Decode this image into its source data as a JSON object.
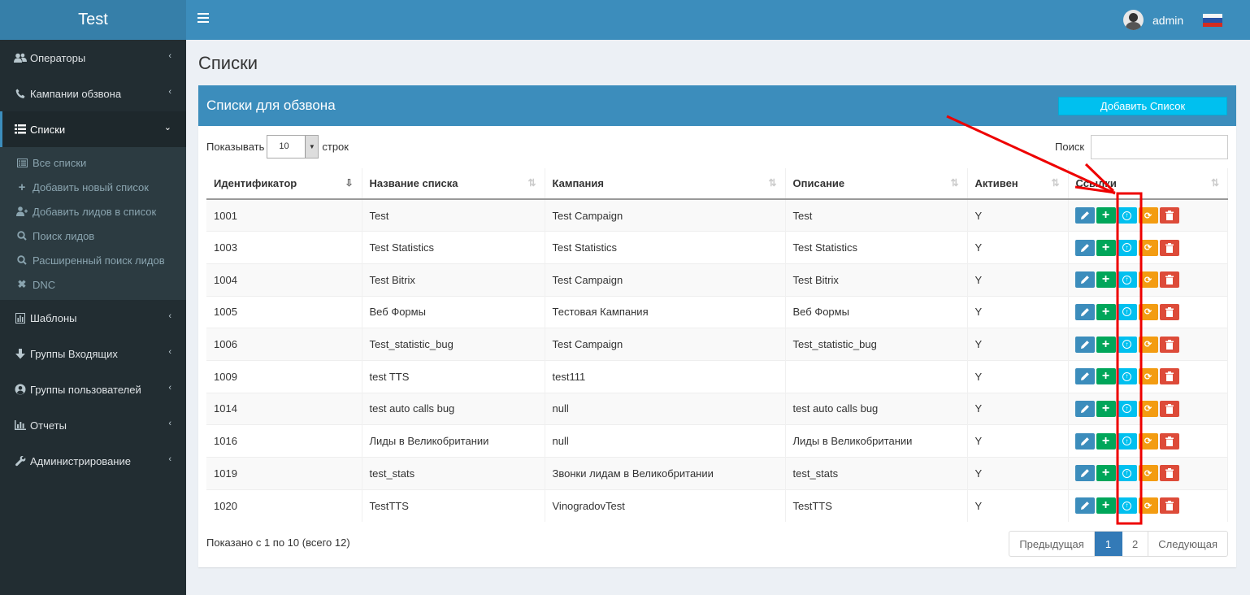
{
  "app": {
    "title": "Test"
  },
  "header": {
    "user": "admin"
  },
  "sidebar": {
    "items": [
      {
        "label": "Операторы",
        "icon": "users-icon"
      },
      {
        "label": "Кампании обзвона",
        "icon": "phone-icon"
      },
      {
        "label": "Списки",
        "icon": "list-icon",
        "active": true
      },
      {
        "label": "Шаблоны",
        "icon": "template-icon"
      },
      {
        "label": "Группы Входящих",
        "icon": "arrow-down-icon"
      },
      {
        "label": "Группы пользователей",
        "icon": "user-circle-icon"
      },
      {
        "label": "Отчеты",
        "icon": "bar-chart-icon"
      },
      {
        "label": "Администрирование",
        "icon": "wrench-icon"
      }
    ],
    "subitems": [
      {
        "label": "Все списки",
        "icon": "list-alt-icon"
      },
      {
        "label": "Добавить новый список",
        "icon": "plus-icon"
      },
      {
        "label": "Добавить лидов в список",
        "icon": "user-plus-icon"
      },
      {
        "label": "Поиск лидов",
        "icon": "search-icon"
      },
      {
        "label": "Расширенный поиск лидов",
        "icon": "search-icon"
      },
      {
        "label": "DNC",
        "icon": "close-icon"
      }
    ]
  },
  "page": {
    "title": "Списки"
  },
  "box": {
    "title": "Списки для обзвона",
    "add_button": "Добавить Список",
    "show_label": "Показывать",
    "page_size": "10",
    "rows_label": "строк",
    "search_label": "Поиск"
  },
  "table": {
    "columns": [
      "Идентификатор",
      "Название списка",
      "Кампания",
      "Описание",
      "Активен",
      "Ссылки"
    ],
    "rows": [
      [
        "1001",
        "Test",
        "Test Campaign",
        "Test",
        "Y"
      ],
      [
        "1003",
        "Test Statistics",
        "Test Statistics",
        "Test Statistics",
        "Y"
      ],
      [
        "1004",
        "Test Bitrix",
        "Test Campaign",
        "Test Bitrix",
        "Y"
      ],
      [
        "1005",
        "Веб Формы",
        "Тестовая Кампания",
        "Веб Формы",
        "Y"
      ],
      [
        "1006",
        "Test_statistic_bug",
        "Test Campaign",
        "Test_statistic_bug",
        "Y"
      ],
      [
        "1009",
        "test TTS",
        "test111",
        "",
        "Y"
      ],
      [
        "1014",
        "test auto calls bug",
        "null",
        "test auto calls bug",
        "Y"
      ],
      [
        "1016",
        "Лиды в Великобритании",
        "null",
        "Лиды в Великобритании",
        "Y"
      ],
      [
        "1019",
        "test_stats",
        "Звонки лидам в Великобритании",
        "test_stats",
        "Y"
      ],
      [
        "1020",
        "TestTTS",
        "VinogradovTest",
        "TestTTS",
        "Y"
      ]
    ]
  },
  "footer": {
    "info": "Показано с 1 по 10 (всего 12)",
    "prev": "Предыдущая",
    "pages": [
      "1",
      "2"
    ],
    "next": "Следующая"
  }
}
